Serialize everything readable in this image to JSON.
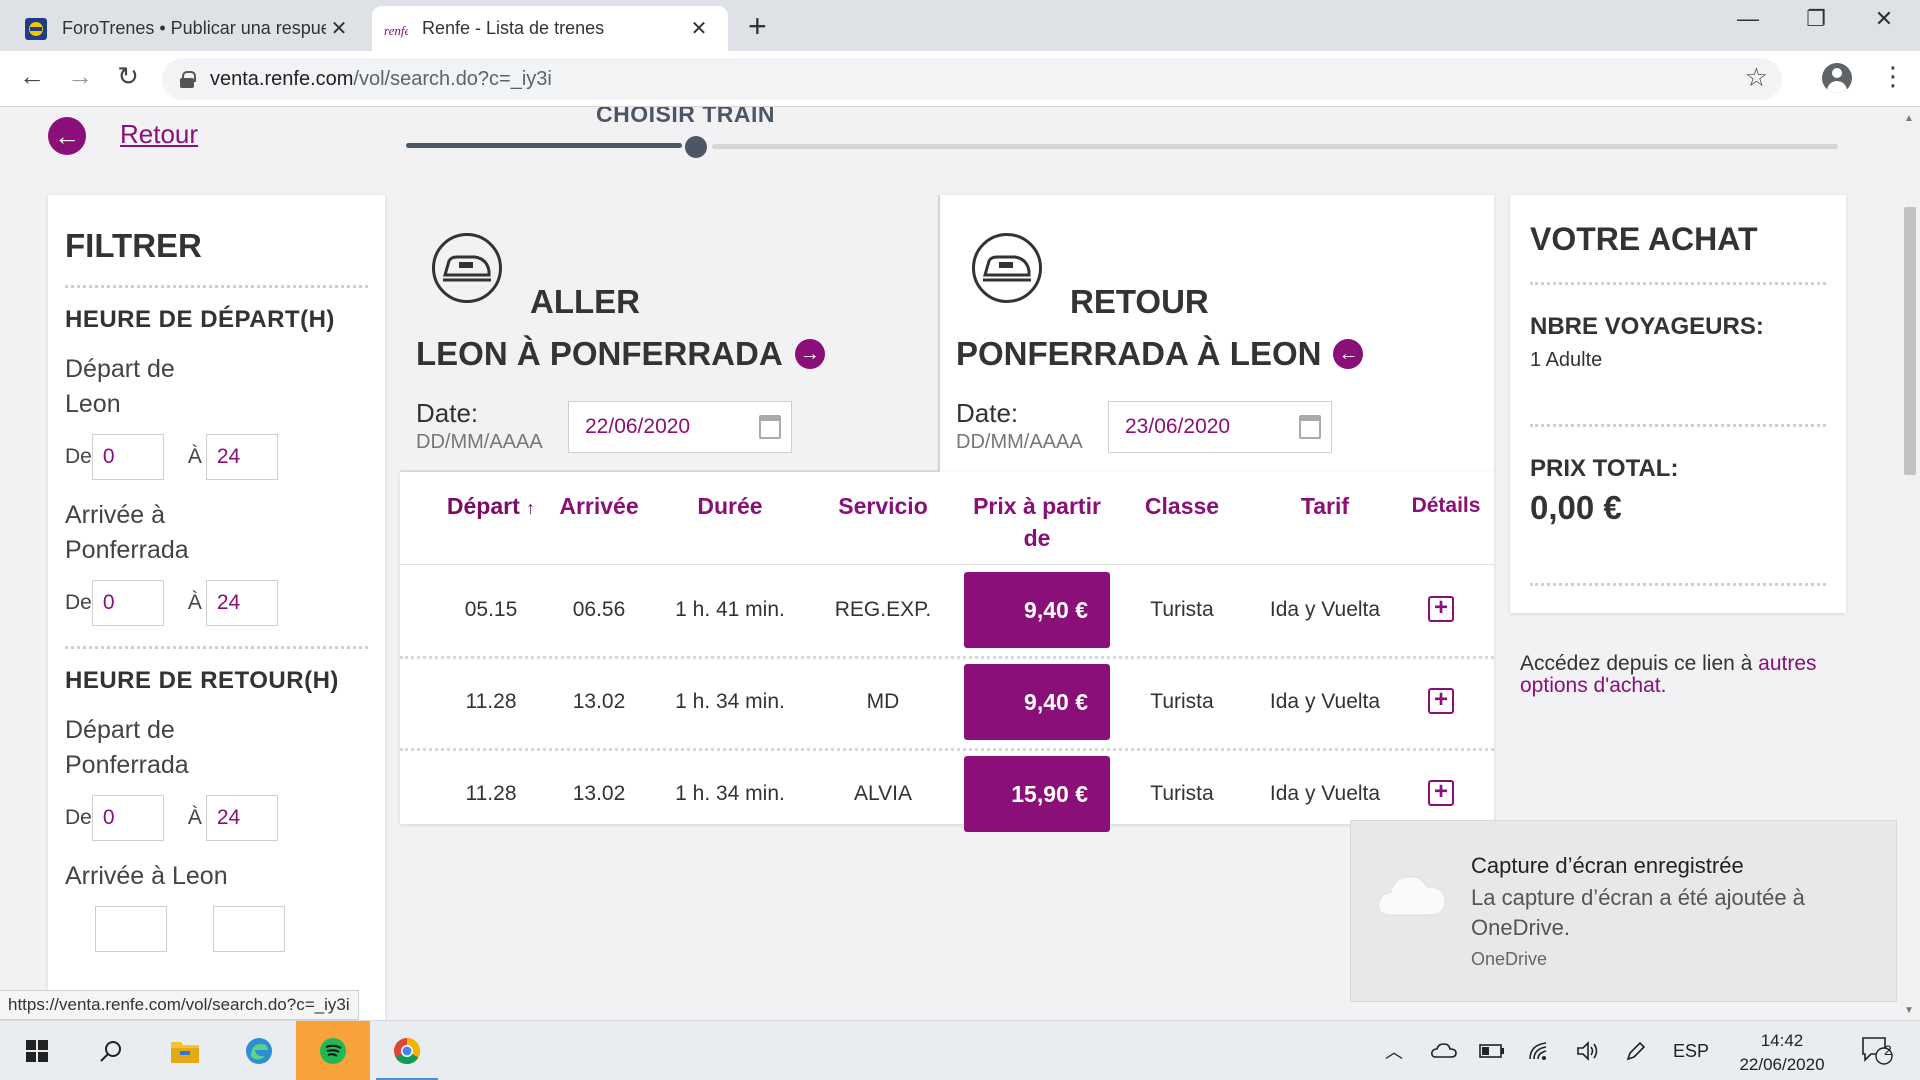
{
  "browser": {
    "tabs": [
      {
        "title": "ForoTrenes • Publicar una respue",
        "active": false
      },
      {
        "title": "Renfe - Lista de trenes",
        "active": true
      }
    ],
    "url_host": "venta.renfe.com",
    "url_path": "/vol/search.do?c=_iy3i",
    "status_url": "https://venta.renfe.com/vol/search.do?c=_iy3i"
  },
  "nav": {
    "back_label": "Retour",
    "step_label": "CHOISIR TRAIN"
  },
  "filter": {
    "title": "FILTRER",
    "departure_section": "HEURE DE DÉPART(H)",
    "return_section": "HEURE DE RETOUR(H)",
    "from_label": "De",
    "to_label": "À",
    "groups": [
      {
        "label": "Départ de Leon",
        "from": "0",
        "to": "24"
      },
      {
        "label": "Arrivée à Ponferrada",
        "from": "0",
        "to": "24"
      },
      {
        "label": "Départ de Ponferrada",
        "from": "0",
        "to": "24"
      },
      {
        "label": "Arrivée à Leon",
        "from": "",
        "to": ""
      }
    ]
  },
  "outbound": {
    "direction": "ALLER",
    "route": "LEON À PONFERRADA",
    "date_label": "Date:",
    "date_format": "DD/MM/AAAA",
    "date": "22/06/2020"
  },
  "inbound": {
    "direction": "RETOUR",
    "route": "PONFERRADA À LEON",
    "date_label": "Date:",
    "date_format": "DD/MM/AAAA",
    "date": "23/06/2020"
  },
  "table": {
    "headers": {
      "depart": "Départ",
      "sort_arrow": "↑",
      "arrivee": "Arrivée",
      "duree": "Durée",
      "servicio": "Servicio",
      "prix": "Prix à partir de",
      "classe": "Classe",
      "tarif": "Tarif",
      "details": "Détails"
    },
    "rows": [
      {
        "depart": "05.15",
        "arrivee": "06.56",
        "duree": "1 h. 41 min.",
        "servicio": "REG.EXP.",
        "prix": "9,40 €",
        "classe": "Turista",
        "tarif": "Ida y Vuelta"
      },
      {
        "depart": "11.28",
        "arrivee": "13.02",
        "duree": "1 h. 34 min.",
        "servicio": "MD",
        "prix": "9,40 €",
        "classe": "Turista",
        "tarif": "Ida y Vuelta"
      },
      {
        "depart": "11.28",
        "arrivee": "13.02",
        "duree": "1 h. 34 min.",
        "servicio": "ALVIA",
        "prix": "15,90 €",
        "classe": "Turista",
        "tarif": "Ida y Vuelta"
      }
    ]
  },
  "summary": {
    "title": "VOTRE ACHAT",
    "travelers_label": "NBRE VOYAGEURS:",
    "travelers_value": "1 Adulte",
    "total_label": "PRIX TOTAL:",
    "total_value": "0,00 €",
    "other_text": "Accédez depuis ce lien à ",
    "other_link": "autres options d'achat."
  },
  "toast": {
    "title": "Capture d’écran enregistrée",
    "body": "La capture d’écran a été ajoutée à OneDrive.",
    "source": "OneDrive"
  },
  "taskbar": {
    "language": "ESP",
    "time": "14:42",
    "date": "22/06/2020",
    "notifications": "2"
  },
  "colors": {
    "brand": "#8a0f78",
    "text": "#333333",
    "page_bg": "#f2f2f4"
  }
}
